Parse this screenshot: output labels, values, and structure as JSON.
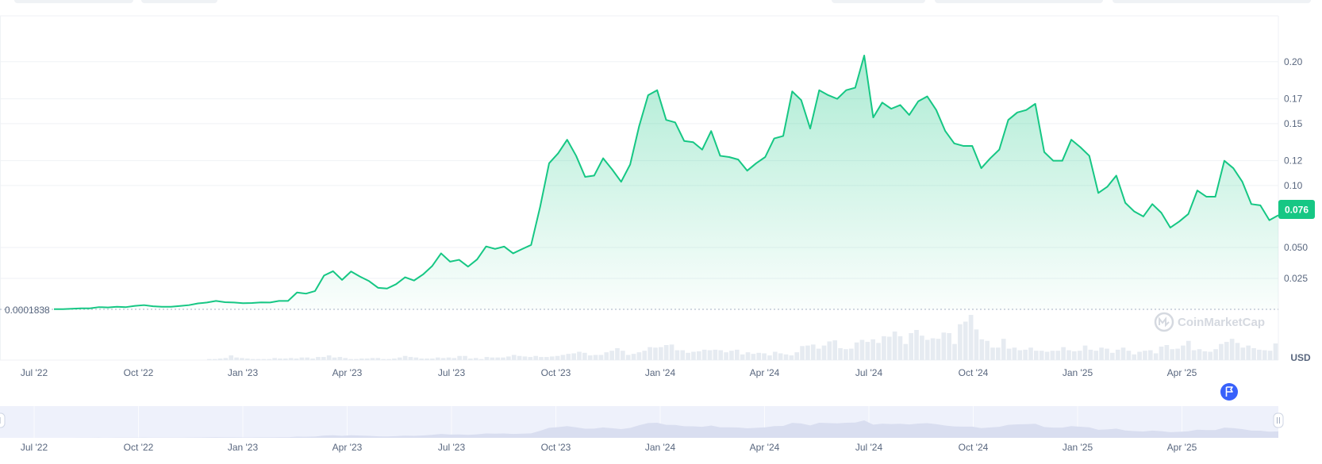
{
  "colors": {
    "line": "#16c784",
    "area_top": "#16c784",
    "grid": "#eff2f5",
    "volume": "#e6ebf1",
    "navigator_bg": "#eef1fb",
    "navigator_area": "#d9def0",
    "flag": "#3861fb",
    "text": "#58667e"
  },
  "watermark": "CoinMarketCap",
  "currency_label": "USD",
  "base_price_label": "0.0001838",
  "current_price_label": "0.076",
  "chart_data": {
    "type": "area",
    "x_tick_labels": [
      "Jul '22",
      "Oct '22",
      "Jan '23",
      "Apr '23",
      "Jul '23",
      "Oct '23",
      "Jan '24",
      "Apr '24",
      "Jul '24",
      "Oct '24",
      "Jan '25",
      "Apr '25"
    ],
    "y_tick_labels": [
      "0.025",
      "0.050",
      "0.10",
      "0.12",
      "0.15",
      "0.17",
      "0.20"
    ],
    "ylim": [
      0,
      0.205
    ],
    "grid": true,
    "current_price": 0.076,
    "series": [
      {
        "values": [
          0.0002,
          0.0002,
          0.0005,
          0.0008,
          0.0008,
          0.0018,
          0.0015,
          0.0021,
          0.0018,
          0.0028,
          0.0034,
          0.0025,
          0.0021,
          0.0021,
          0.0027,
          0.0034,
          0.0048,
          0.0055,
          0.0068,
          0.0058,
          0.0055,
          0.005,
          0.0051,
          0.0056,
          0.0055,
          0.0068,
          0.0068,
          0.0136,
          0.0127,
          0.0148,
          0.0273,
          0.0308,
          0.0238,
          0.0306,
          0.0264,
          0.0228,
          0.0174,
          0.0168,
          0.0203,
          0.0259,
          0.0233,
          0.0282,
          0.0349,
          0.0452,
          0.0385,
          0.04,
          0.0345,
          0.0403,
          0.0508,
          0.0488,
          0.0507,
          0.0452,
          0.0487,
          0.052,
          0.0827,
          0.118,
          0.126,
          0.137,
          0.124,
          0.107,
          0.108,
          0.122,
          0.113,
          0.103,
          0.117,
          0.148,
          0.173,
          0.177,
          0.153,
          0.151,
          0.136,
          0.135,
          0.129,
          0.144,
          0.124,
          0.123,
          0.121,
          0.112,
          0.118,
          0.123,
          0.138,
          0.14,
          0.176,
          0.169,
          0.146,
          0.177,
          0.173,
          0.17,
          0.177,
          0.179,
          0.205,
          0.155,
          0.167,
          0.162,
          0.165,
          0.157,
          0.168,
          0.172,
          0.161,
          0.144,
          0.134,
          0.132,
          0.132,
          0.114,
          0.122,
          0.129,
          0.153,
          0.159,
          0.161,
          0.166,
          0.127,
          0.12,
          0.12,
          0.137,
          0.131,
          0.124,
          0.094,
          0.099,
          0.108,
          0.086,
          0.079,
          0.075,
          0.085,
          0.078,
          0.066,
          0.071,
          0.077,
          0.096,
          0.091,
          0.091,
          0.12,
          0.114,
          0.103,
          0.085,
          0.084,
          0.072,
          0.076
        ]
      }
    ],
    "volume": [
      0,
      0,
      0,
      0,
      0,
      0,
      0,
      0,
      0,
      0,
      0,
      0,
      0,
      0,
      0,
      0,
      0,
      0,
      0,
      0,
      0,
      0,
      0,
      0,
      0,
      0,
      0,
      0,
      0,
      0,
      0,
      0,
      0,
      0,
      0,
      0,
      0,
      0,
      0.02,
      0.02,
      0.03,
      0.04,
      0.09,
      0.05,
      0.04,
      0.03,
      0.02,
      0.02,
      0.02,
      0.02,
      0.04,
      0.03,
      0.03,
      0.04,
      0.03,
      0.05,
      0.05,
      0.03,
      0.06,
      0.06,
      0.09,
      0.05,
      0.06,
      0.04,
      0.02,
      0.02,
      0.03,
      0.03,
      0.04,
      0.04,
      0.02,
      0.02,
      0.03,
      0.05,
      0.08,
      0.06,
      0.05,
      0.03,
      0.03,
      0.03,
      0.05,
      0.04,
      0.05,
      0.04,
      0.08,
      0.08,
      0.03,
      0.04,
      0.02,
      0.06,
      0.05,
      0.05,
      0.05,
      0.07,
      0.1,
      0.08,
      0.07,
      0.06,
      0.08,
      0.06,
      0.06,
      0.07,
      0.08,
      0.1,
      0.12,
      0.13,
      0.16,
      0.14,
      0.09,
      0.1,
      0.1,
      0.15,
      0.18,
      0.23,
      0.18,
      0.1,
      0.12,
      0.15,
      0.18,
      0.25,
      0.24,
      0.25,
      0.29,
      0.3,
      0.19,
      0.19,
      0.14,
      0.16,
      0.17,
      0.2,
      0.19,
      0.2,
      0.19,
      0.15,
      0.18,
      0.2,
      0.11,
      0.15,
      0.12,
      0.14,
      0.13,
      0.09,
      0.16,
      0.13,
      0.11,
      0.09,
      0.15,
      0.27,
      0.28,
      0.3,
      0.22,
      0.28,
      0.36,
      0.38,
      0.23,
      0.21,
      0.22,
      0.34,
      0.39,
      0.35,
      0.4,
      0.33,
      0.46,
      0.45,
      0.55,
      0.46,
      0.31,
      0.52,
      0.58,
      0.47,
      0.39,
      0.42,
      0.41,
      0.53,
      0.52,
      0.31,
      0.69,
      0.74,
      0.87,
      0.59,
      0.4,
      0.37,
      0.24,
      0.24,
      0.41,
      0.22,
      0.24,
      0.19,
      0.2,
      0.24,
      0.18,
      0.18,
      0.16,
      0.18,
      0.18,
      0.25,
      0.19,
      0.17,
      0.18,
      0.28,
      0.2,
      0.18,
      0.24,
      0.22,
      0.14,
      0.2,
      0.24,
      0.18,
      0.11,
      0.16,
      0.18,
      0.19,
      0.13,
      0.26,
      0.29,
      0.21,
      0.22,
      0.28,
      0.37,
      0.19,
      0.21,
      0.17,
      0.16,
      0.21,
      0.31,
      0.35,
      0.41,
      0.33,
      0.24,
      0.28,
      0.23,
      0.2,
      0.19,
      0.18,
      0.32
    ]
  }
}
